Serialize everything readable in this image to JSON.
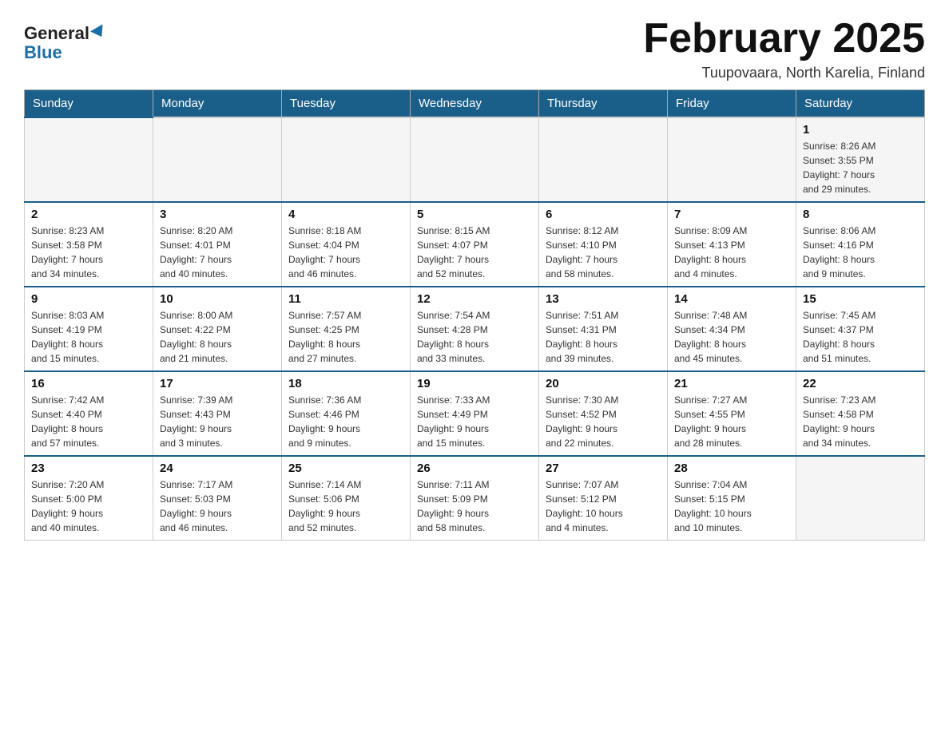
{
  "header": {
    "logo_line1": "General",
    "logo_line2": "Blue",
    "title": "February 2025",
    "subtitle": "Tuupovaara, North Karelia, Finland"
  },
  "weekdays": [
    "Sunday",
    "Monday",
    "Tuesday",
    "Wednesday",
    "Thursday",
    "Friday",
    "Saturday"
  ],
  "weeks": [
    {
      "days": [
        {
          "num": "",
          "info": ""
        },
        {
          "num": "",
          "info": ""
        },
        {
          "num": "",
          "info": ""
        },
        {
          "num": "",
          "info": ""
        },
        {
          "num": "",
          "info": ""
        },
        {
          "num": "",
          "info": ""
        },
        {
          "num": "1",
          "info": "Sunrise: 8:26 AM\nSunset: 3:55 PM\nDaylight: 7 hours\nand 29 minutes."
        }
      ]
    },
    {
      "days": [
        {
          "num": "2",
          "info": "Sunrise: 8:23 AM\nSunset: 3:58 PM\nDaylight: 7 hours\nand 34 minutes."
        },
        {
          "num": "3",
          "info": "Sunrise: 8:20 AM\nSunset: 4:01 PM\nDaylight: 7 hours\nand 40 minutes."
        },
        {
          "num": "4",
          "info": "Sunrise: 8:18 AM\nSunset: 4:04 PM\nDaylight: 7 hours\nand 46 minutes."
        },
        {
          "num": "5",
          "info": "Sunrise: 8:15 AM\nSunset: 4:07 PM\nDaylight: 7 hours\nand 52 minutes."
        },
        {
          "num": "6",
          "info": "Sunrise: 8:12 AM\nSunset: 4:10 PM\nDaylight: 7 hours\nand 58 minutes."
        },
        {
          "num": "7",
          "info": "Sunrise: 8:09 AM\nSunset: 4:13 PM\nDaylight: 8 hours\nand 4 minutes."
        },
        {
          "num": "8",
          "info": "Sunrise: 8:06 AM\nSunset: 4:16 PM\nDaylight: 8 hours\nand 9 minutes."
        }
      ]
    },
    {
      "days": [
        {
          "num": "9",
          "info": "Sunrise: 8:03 AM\nSunset: 4:19 PM\nDaylight: 8 hours\nand 15 minutes."
        },
        {
          "num": "10",
          "info": "Sunrise: 8:00 AM\nSunset: 4:22 PM\nDaylight: 8 hours\nand 21 minutes."
        },
        {
          "num": "11",
          "info": "Sunrise: 7:57 AM\nSunset: 4:25 PM\nDaylight: 8 hours\nand 27 minutes."
        },
        {
          "num": "12",
          "info": "Sunrise: 7:54 AM\nSunset: 4:28 PM\nDaylight: 8 hours\nand 33 minutes."
        },
        {
          "num": "13",
          "info": "Sunrise: 7:51 AM\nSunset: 4:31 PM\nDaylight: 8 hours\nand 39 minutes."
        },
        {
          "num": "14",
          "info": "Sunrise: 7:48 AM\nSunset: 4:34 PM\nDaylight: 8 hours\nand 45 minutes."
        },
        {
          "num": "15",
          "info": "Sunrise: 7:45 AM\nSunset: 4:37 PM\nDaylight: 8 hours\nand 51 minutes."
        }
      ]
    },
    {
      "days": [
        {
          "num": "16",
          "info": "Sunrise: 7:42 AM\nSunset: 4:40 PM\nDaylight: 8 hours\nand 57 minutes."
        },
        {
          "num": "17",
          "info": "Sunrise: 7:39 AM\nSunset: 4:43 PM\nDaylight: 9 hours\nand 3 minutes."
        },
        {
          "num": "18",
          "info": "Sunrise: 7:36 AM\nSunset: 4:46 PM\nDaylight: 9 hours\nand 9 minutes."
        },
        {
          "num": "19",
          "info": "Sunrise: 7:33 AM\nSunset: 4:49 PM\nDaylight: 9 hours\nand 15 minutes."
        },
        {
          "num": "20",
          "info": "Sunrise: 7:30 AM\nSunset: 4:52 PM\nDaylight: 9 hours\nand 22 minutes."
        },
        {
          "num": "21",
          "info": "Sunrise: 7:27 AM\nSunset: 4:55 PM\nDaylight: 9 hours\nand 28 minutes."
        },
        {
          "num": "22",
          "info": "Sunrise: 7:23 AM\nSunset: 4:58 PM\nDaylight: 9 hours\nand 34 minutes."
        }
      ]
    },
    {
      "days": [
        {
          "num": "23",
          "info": "Sunrise: 7:20 AM\nSunset: 5:00 PM\nDaylight: 9 hours\nand 40 minutes."
        },
        {
          "num": "24",
          "info": "Sunrise: 7:17 AM\nSunset: 5:03 PM\nDaylight: 9 hours\nand 46 minutes."
        },
        {
          "num": "25",
          "info": "Sunrise: 7:14 AM\nSunset: 5:06 PM\nDaylight: 9 hours\nand 52 minutes."
        },
        {
          "num": "26",
          "info": "Sunrise: 7:11 AM\nSunset: 5:09 PM\nDaylight: 9 hours\nand 58 minutes."
        },
        {
          "num": "27",
          "info": "Sunrise: 7:07 AM\nSunset: 5:12 PM\nDaylight: 10 hours\nand 4 minutes."
        },
        {
          "num": "28",
          "info": "Sunrise: 7:04 AM\nSunset: 5:15 PM\nDaylight: 10 hours\nand 10 minutes."
        },
        {
          "num": "",
          "info": ""
        }
      ]
    }
  ]
}
